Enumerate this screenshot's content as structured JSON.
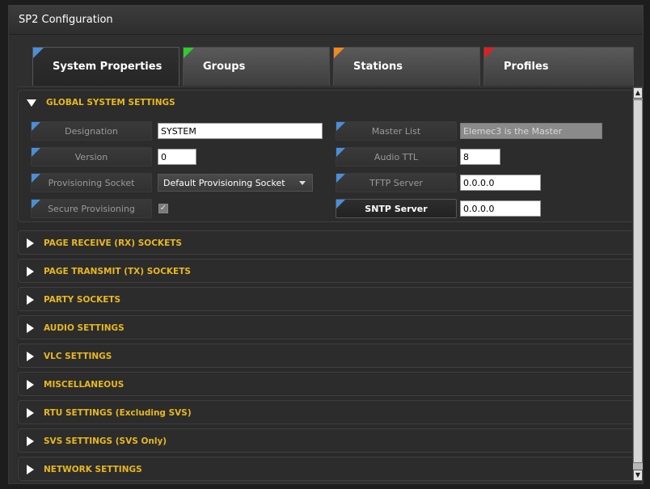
{
  "window": {
    "title": "SP2 Configuration"
  },
  "tabs": [
    {
      "label": "System Properties",
      "flag_color": "#4a8fd8",
      "active": true
    },
    {
      "label": "Groups",
      "flag_color": "#2ecc2e",
      "active": false
    },
    {
      "label": "Stations",
      "flag_color": "#f08a1c",
      "active": false
    },
    {
      "label": "Profiles",
      "flag_color": "#e02020",
      "active": false
    }
  ],
  "global": {
    "title": "GLOBAL SYSTEM SETTINGS",
    "designation": {
      "label": "Designation",
      "value": "SYSTEM"
    },
    "version": {
      "label": "Version",
      "value": "0"
    },
    "provisioning_socket": {
      "label": "Provisioning Socket",
      "value": "Default Provisioning Socket"
    },
    "secure_provisioning": {
      "label": "Secure Provisioning",
      "checked": true,
      "check_glyph": "✓"
    },
    "master_list": {
      "label": "Master List",
      "value": "Elemec3 is the Master"
    },
    "audio_ttl": {
      "label": "Audio TTL",
      "value": "8"
    },
    "tftp_server": {
      "label": "TFTP Server",
      "value": "0.0.0.0"
    },
    "sntp_server": {
      "label": "SNTP Server",
      "value": "0.0.0.0"
    }
  },
  "sections": [
    {
      "title": "PAGE RECEIVE (RX) SOCKETS"
    },
    {
      "title": "PAGE TRANSMIT (TX) SOCKETS"
    },
    {
      "title": "PARTY SOCKETS"
    },
    {
      "title": "AUDIO SETTINGS"
    },
    {
      "title": "VLC SETTINGS"
    },
    {
      "title": "MISCELLANEOUS"
    },
    {
      "title": "RTU SETTINGS (Excluding SVS)"
    },
    {
      "title": "SVS SETTINGS (SVS Only)"
    },
    {
      "title": "NETWORK SETTINGS"
    }
  ],
  "scrollbar": {
    "up_glyph": "▲",
    "down_glyph": "▼"
  }
}
